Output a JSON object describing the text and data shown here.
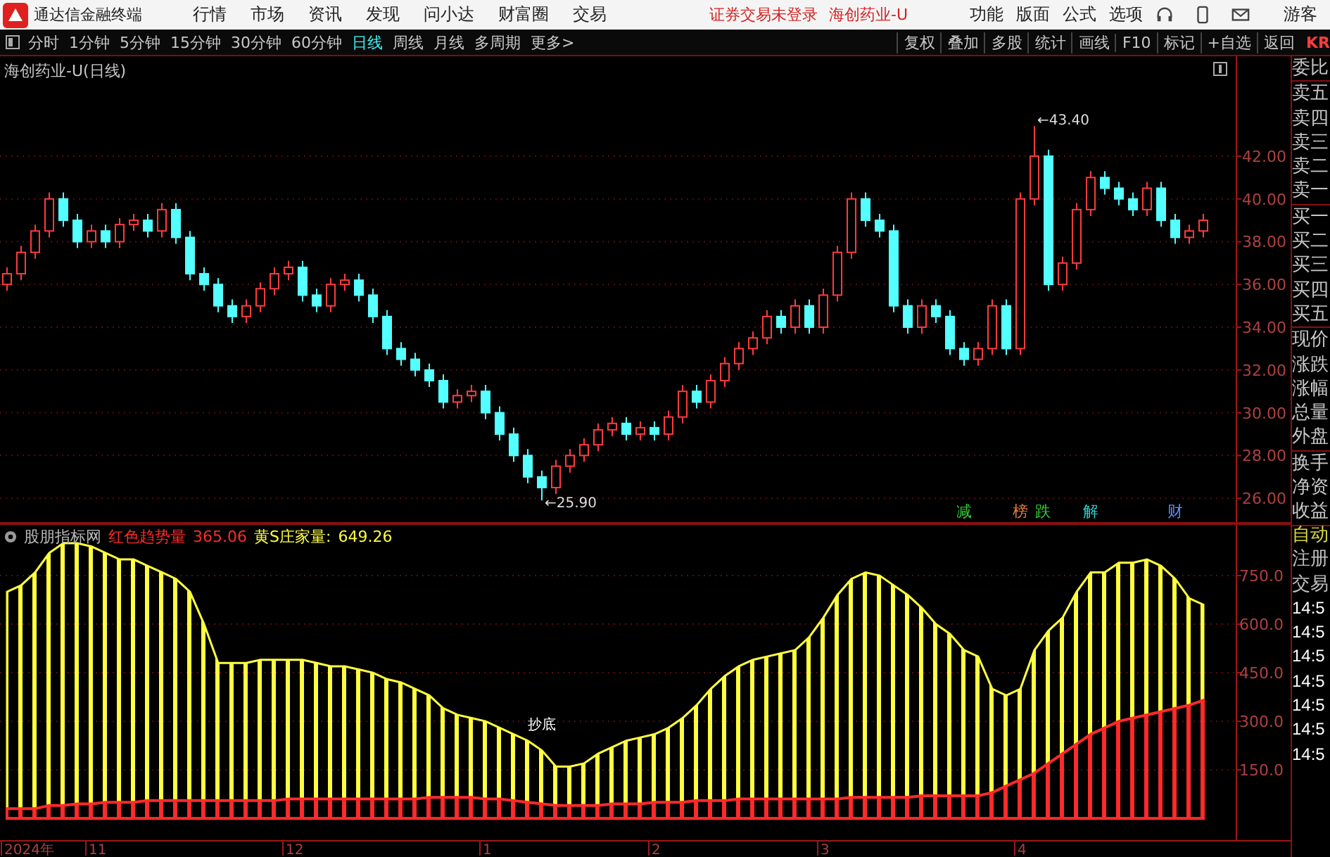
{
  "top_bar": {
    "app_title": "通达信金融终端",
    "menu": [
      "行情",
      "市场",
      "资讯",
      "发现",
      "问小达",
      "财富圈",
      "交易"
    ],
    "notices": [
      "证券交易未登录",
      "海创药业-U"
    ],
    "actions": [
      "功能",
      "版面",
      "公式",
      "选项"
    ],
    "user": "游客"
  },
  "toolbar": {
    "periods": [
      {
        "label": "分时",
        "selected": false
      },
      {
        "label": "1分钟",
        "selected": false
      },
      {
        "label": "5分钟",
        "selected": false
      },
      {
        "label": "15分钟",
        "selected": false
      },
      {
        "label": "30分钟",
        "selected": false
      },
      {
        "label": "60分钟",
        "selected": false
      },
      {
        "label": "日线",
        "selected": true
      },
      {
        "label": "周线",
        "selected": false
      },
      {
        "label": "月线",
        "selected": false
      },
      {
        "label": "多周期",
        "selected": false
      },
      {
        "label": "更多>",
        "selected": false
      }
    ],
    "tools": [
      "复权",
      "叠加",
      "多股",
      "统计",
      "画线",
      "F10",
      "标记",
      "+自选",
      "返回"
    ],
    "edge_text": "KR"
  },
  "main_chart": {
    "title": "海创药业-U(日线)",
    "chart_data": {
      "type": "candlestick",
      "grid": true,
      "ylim": [
        24.82,
        46.67
      ],
      "yticks": [
        {
          "value": 42,
          "label": "42.00"
        },
        {
          "value": 40,
          "label": "40.00"
        },
        {
          "value": 38,
          "label": "38.00"
        },
        {
          "value": 36,
          "label": "36.00"
        },
        {
          "value": 34,
          "label": "34.00"
        },
        {
          "value": 32,
          "label": "32.00"
        },
        {
          "value": 30,
          "label": "30.00"
        },
        {
          "value": 28,
          "label": "28.00"
        },
        {
          "value": 26,
          "label": "26.00"
        }
      ],
      "ohlc": [
        [
          36,
          36.8,
          35.7,
          36.5
        ],
        [
          36.5,
          37.8,
          36.2,
          37.5
        ],
        [
          37.5,
          38.8,
          37.2,
          38.5
        ],
        [
          38.5,
          40.3,
          38.2,
          40
        ],
        [
          40,
          40.3,
          38.7,
          39
        ],
        [
          39,
          39.3,
          37.7,
          38
        ],
        [
          38,
          38.8,
          37.7,
          38.5
        ],
        [
          38.5,
          38.8,
          37.7,
          38
        ],
        [
          38,
          39.1,
          37.7,
          38.8
        ],
        [
          38.8,
          39.3,
          38.5,
          39
        ],
        [
          39,
          39.3,
          38.2,
          38.5
        ],
        [
          38.5,
          39.8,
          38.2,
          39.5
        ],
        [
          39.5,
          39.8,
          37.9,
          38.2
        ],
        [
          38.2,
          38.5,
          36.2,
          36.5
        ],
        [
          36.5,
          36.8,
          35.7,
          36
        ],
        [
          36,
          36.3,
          34.7,
          35
        ],
        [
          35,
          35.3,
          34.2,
          34.5
        ],
        [
          34.5,
          35.3,
          34.2,
          35
        ],
        [
          35,
          36.1,
          34.7,
          35.8
        ],
        [
          35.8,
          36.8,
          35.5,
          36.5
        ],
        [
          36.5,
          37.1,
          36.2,
          36.8
        ],
        [
          36.8,
          37.1,
          35.2,
          35.5
        ],
        [
          35.5,
          35.8,
          34.7,
          35
        ],
        [
          35,
          36.3,
          34.7,
          36
        ],
        [
          36,
          36.5,
          35.7,
          36.2
        ],
        [
          36.2,
          36.5,
          35.2,
          35.5
        ],
        [
          35.5,
          35.8,
          34.2,
          34.5
        ],
        [
          34.5,
          34.8,
          32.7,
          33
        ],
        [
          33,
          33.3,
          32.2,
          32.5
        ],
        [
          32.5,
          32.8,
          31.7,
          32
        ],
        [
          32,
          32.3,
          31.2,
          31.5
        ],
        [
          31.5,
          31.8,
          30.2,
          30.5
        ],
        [
          30.5,
          31.1,
          30.2,
          30.8
        ],
        [
          30.8,
          31.3,
          30.5,
          31
        ],
        [
          31,
          31.3,
          29.7,
          30
        ],
        [
          30,
          30.3,
          28.7,
          29
        ],
        [
          29,
          29.3,
          27.7,
          28
        ],
        [
          28,
          28.3,
          26.7,
          27
        ],
        [
          27,
          27.3,
          25.9,
          26.5
        ],
        [
          26.5,
          27.8,
          26.2,
          27.5
        ],
        [
          27.5,
          28.3,
          27.2,
          28
        ],
        [
          28,
          28.8,
          27.7,
          28.5
        ],
        [
          28.5,
          29.5,
          28.2,
          29.2
        ],
        [
          29.2,
          29.8,
          28.9,
          29.5
        ],
        [
          29.5,
          29.8,
          28.7,
          29
        ],
        [
          29,
          29.6,
          28.7,
          29.3
        ],
        [
          29.3,
          29.6,
          28.7,
          29
        ],
        [
          29,
          30.1,
          28.7,
          29.8
        ],
        [
          29.8,
          31.3,
          29.5,
          31
        ],
        [
          31,
          31.3,
          30.2,
          30.5
        ],
        [
          30.5,
          31.8,
          30.2,
          31.5
        ],
        [
          31.5,
          32.6,
          31.2,
          32.3
        ],
        [
          32.3,
          33.3,
          32,
          33
        ],
        [
          33,
          33.8,
          32.7,
          33.5
        ],
        [
          33.5,
          34.8,
          33.2,
          34.5
        ],
        [
          34.5,
          34.8,
          33.7,
          34
        ],
        [
          34,
          35.3,
          33.7,
          35
        ],
        [
          35,
          35.3,
          33.7,
          34
        ],
        [
          34,
          35.8,
          33.7,
          35.5
        ],
        [
          35.5,
          37.8,
          35.2,
          37.5
        ],
        [
          37.5,
          40.3,
          37.2,
          40
        ],
        [
          40,
          40.3,
          38.7,
          39
        ],
        [
          39,
          39.3,
          38.2,
          38.5
        ],
        [
          38.5,
          38.8,
          34.7,
          35
        ],
        [
          35,
          35.3,
          33.7,
          34
        ],
        [
          34,
          35.3,
          33.7,
          35
        ],
        [
          35,
          35.3,
          34.2,
          34.5
        ],
        [
          34.5,
          34.8,
          32.7,
          33
        ],
        [
          33,
          33.3,
          32.2,
          32.5
        ],
        [
          32.5,
          33.3,
          32.2,
          33
        ],
        [
          33,
          35.3,
          32.7,
          35
        ],
        [
          35,
          35.3,
          32.7,
          33
        ],
        [
          33,
          40.3,
          32.7,
          40
        ],
        [
          40,
          43.4,
          39.7,
          42
        ],
        [
          42,
          42.3,
          35.7,
          36
        ],
        [
          36,
          37.3,
          35.7,
          37
        ],
        [
          37,
          39.8,
          36.7,
          39.5
        ],
        [
          39.5,
          41.3,
          39.2,
          41
        ],
        [
          41,
          41.3,
          40.2,
          40.5
        ],
        [
          40.5,
          40.8,
          39.7,
          40
        ],
        [
          40,
          40.3,
          39.2,
          39.5
        ],
        [
          39.5,
          40.8,
          39.2,
          40.5
        ],
        [
          40.5,
          40.8,
          38.7,
          39
        ],
        [
          39,
          39.3,
          37.9,
          38.2
        ],
        [
          38.2,
          38.8,
          37.9,
          38.5
        ],
        [
          38.5,
          39.3,
          38.2,
          39
        ]
      ],
      "annotations": [
        {
          "text": "←43.40"
        },
        {
          "text": "←25.90"
        }
      ]
    },
    "events": [
      {
        "text": "减",
        "color": "#33cc33"
      },
      {
        "text": "榜",
        "color": "#e07a3c"
      },
      {
        "text": "跌",
        "color": "#33cc33"
      },
      {
        "text": "解",
        "color": "#33cccc"
      },
      {
        "text": "财",
        "color": "#5a8cff"
      }
    ]
  },
  "indicator": {
    "source": "股朋指标网",
    "readings": [
      {
        "value": "365.06"
      },
      {
        "separator": ":",
        "value": "649.26"
      }
    ],
    "signal_label": "抄底",
    "date_axis": [
      "2024年",
      "11",
      "12",
      "1",
      "2",
      "3",
      "4"
    ],
    "chart_data": {
      "type": "area",
      "grid": true,
      "ylim": [
        -67,
        911
      ],
      "yticks": [
        {
          "value": 750,
          "label": "750.0"
        },
        {
          "value": 600,
          "label": "600.0"
        },
        {
          "value": 450,
          "label": "450.0"
        },
        {
          "value": 300,
          "label": "300.0"
        },
        {
          "value": 150,
          "label": "150.0"
        }
      ],
      "series": [
        {
          "name": "红色趋势量",
          "color": "#ff2a2a",
          "values": [
            30,
            30,
            30,
            40,
            40,
            45,
            45,
            50,
            50,
            50,
            55,
            55,
            55,
            55,
            55,
            55,
            55,
            55,
            55,
            55,
            60,
            60,
            60,
            60,
            60,
            60,
            60,
            60,
            60,
            60,
            65,
            65,
            65,
            65,
            60,
            60,
            55,
            50,
            45,
            40,
            40,
            40,
            40,
            45,
            45,
            45,
            50,
            50,
            50,
            55,
            55,
            55,
            60,
            60,
            60,
            60,
            60,
            60,
            60,
            60,
            65,
            65,
            65,
            65,
            65,
            70,
            70,
            70,
            70,
            70,
            80,
            100,
            120,
            140,
            170,
            200,
            230,
            260,
            280,
            300,
            310,
            320,
            330,
            340,
            350,
            365
          ]
        },
        {
          "name": "黄S庄家量",
          "color": "#ffff40",
          "values": [
            700,
            720,
            760,
            820,
            850,
            850,
            840,
            820,
            800,
            800,
            780,
            760,
            740,
            700,
            600,
            480,
            480,
            480,
            490,
            490,
            490,
            490,
            480,
            470,
            470,
            460,
            450,
            430,
            420,
            400,
            380,
            340,
            320,
            310,
            300,
            280,
            260,
            240,
            210,
            160,
            160,
            170,
            200,
            220,
            240,
            250,
            260,
            280,
            310,
            350,
            400,
            440,
            470,
            490,
            500,
            510,
            520,
            560,
            620,
            690,
            740,
            760,
            750,
            720,
            690,
            650,
            600,
            570,
            520,
            500,
            400,
            380,
            400,
            520,
            580,
            620,
            700,
            760,
            760,
            790,
            790,
            800,
            780,
            740,
            680,
            660
          ]
        }
      ]
    }
  },
  "side_panel": {
    "upper_groups": [
      [
        "委比"
      ],
      [
        "卖五",
        "卖四",
        "卖三",
        "卖二",
        "卖一"
      ],
      [
        "买一",
        "买二",
        "买三",
        "买四",
        "买五"
      ],
      [
        "现价",
        "涨跌",
        "涨幅",
        "总量",
        "外盘"
      ],
      [
        "换手",
        "净资",
        "收益"
      ]
    ],
    "lower_items": [
      {
        "text": "自动",
        "color": "#d8d840"
      },
      {
        "text": "注册",
        "color": "#c0c0c0"
      },
      {
        "text": "交易",
        "color": "#c0c0c0"
      },
      {
        "text": "14:5",
        "color": "#ffffff"
      },
      {
        "text": "14:5",
        "color": "#ffffff"
      },
      {
        "text": "14:5",
        "color": "#ffffff"
      },
      {
        "text": "14:5",
        "color": "#ffffff"
      },
      {
        "text": "14:5",
        "color": "#ffffff"
      },
      {
        "text": "14:5",
        "color": "#ffffff"
      },
      {
        "text": "14:5",
        "color": "#ffffff"
      }
    ]
  }
}
